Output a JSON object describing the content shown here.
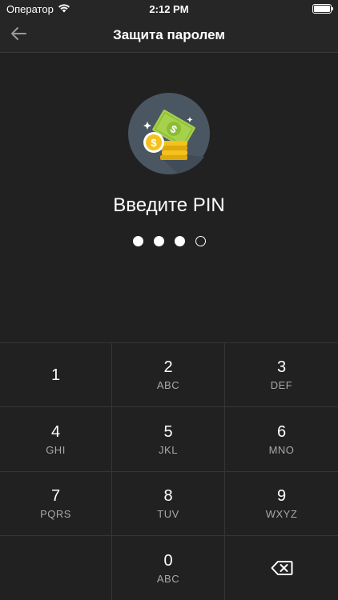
{
  "status_bar": {
    "carrier": "Оператор",
    "time": "2:12 PM",
    "icons": [
      "wifi-icon",
      "battery-icon"
    ]
  },
  "nav": {
    "title": "Защита паролем",
    "back_icon": "arrow-left-icon"
  },
  "illustration": {
    "icon": "money-coins-icon",
    "colors": {
      "circle": "#4a5763",
      "bill": "#a5d24a",
      "coin": "#f4c21b"
    }
  },
  "prompt": "Введите PIN",
  "pin": {
    "length": 4,
    "entered": 3
  },
  "keypad": {
    "keys": [
      {
        "digit": "1",
        "letters": ""
      },
      {
        "digit": "2",
        "letters": "ABC"
      },
      {
        "digit": "3",
        "letters": "DEF"
      },
      {
        "digit": "4",
        "letters": "GHI"
      },
      {
        "digit": "5",
        "letters": "JKL"
      },
      {
        "digit": "6",
        "letters": "MNO"
      },
      {
        "digit": "7",
        "letters": "PQRS"
      },
      {
        "digit": "8",
        "letters": "TUV"
      },
      {
        "digit": "9",
        "letters": "WXYZ"
      },
      {
        "digit": "0",
        "letters": "ABC"
      }
    ],
    "delete_icon": "backspace-icon"
  },
  "colors": {
    "background": "#212121",
    "divider": "#353535",
    "text": "#ffffff",
    "subtext": "#a8a8a8"
  }
}
